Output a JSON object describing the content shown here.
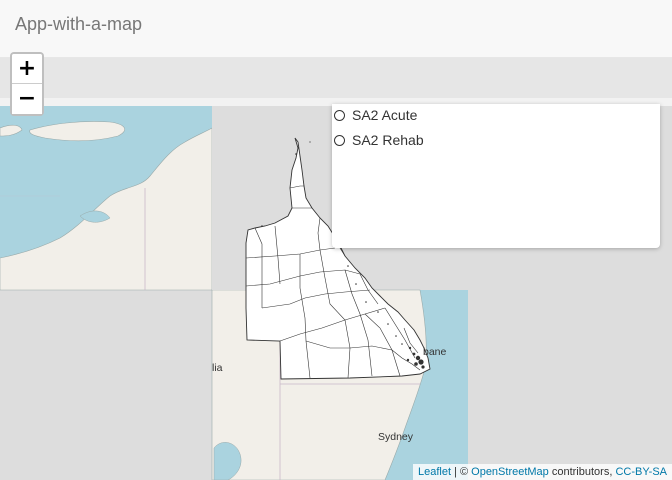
{
  "app": {
    "title": "App-with-a-map"
  },
  "zoom": {
    "in_label": "+",
    "out_label": "−"
  },
  "layers": {
    "options": [
      {
        "label": "SA2 Acute",
        "selected": false
      },
      {
        "label": "SA2 Rehab",
        "selected": false
      }
    ]
  },
  "map": {
    "city_labels": {
      "brisbane": "bane",
      "sydney": "Sydney",
      "australia": "lia"
    },
    "colors": {
      "water": "#aad3df",
      "land": "#f2efe9",
      "region_fill": "#ffffff",
      "region_border": "#333333"
    }
  },
  "attribution": {
    "leaflet": "Leaflet",
    "sep1": " | © ",
    "osm": "OpenStreetMap",
    "contributors": " contributors, ",
    "license": "CC-BY-SA"
  }
}
